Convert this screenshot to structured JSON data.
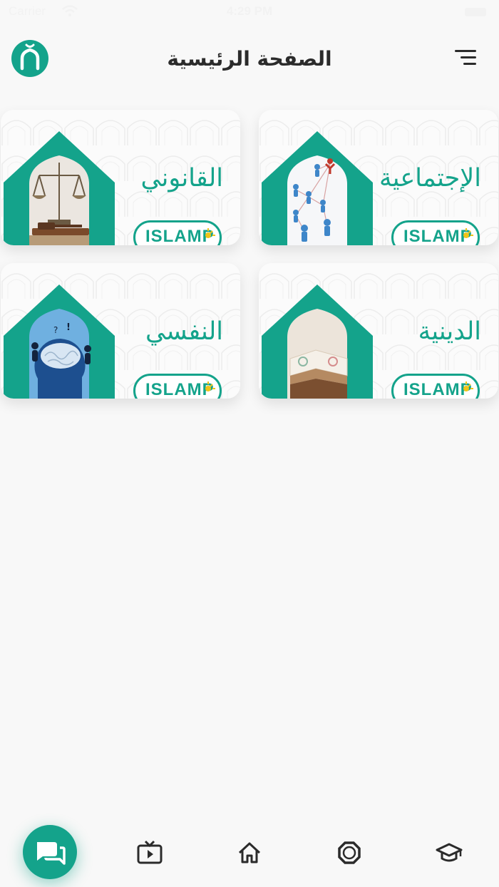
{
  "status_bar": {
    "carrier": "Carrier",
    "time": "4:29 PM"
  },
  "header": {
    "title": "الصفحة الرئيسية",
    "logo_icon": "islamic-arch-logo-icon",
    "menu_icon": "hamburger-menu-icon"
  },
  "theme": {
    "accent": "#14a38b",
    "background": "#f8f8f8",
    "brand_sun": "#f0c419"
  },
  "categories": [
    {
      "title": "الإجتماعية",
      "image": "people-network-image",
      "brand": "ISLAMP"
    },
    {
      "title": "القانوني",
      "image": "scales-and-gavel-image",
      "brand": "ISLAMP"
    },
    {
      "title": "الدينية",
      "image": "open-quran-book-image",
      "brand": "ISLAMP"
    },
    {
      "title": "النفسي",
      "image": "brain-puzzle-head-image",
      "brand": "ISLAMP"
    }
  ],
  "tab_bar": {
    "items": [
      {
        "icon": "chat-bubbles-icon"
      },
      {
        "icon": "tv-play-icon"
      },
      {
        "icon": "home-icon"
      },
      {
        "icon": "octagon-ring-icon"
      },
      {
        "icon": "graduation-cap-icon"
      }
    ]
  }
}
